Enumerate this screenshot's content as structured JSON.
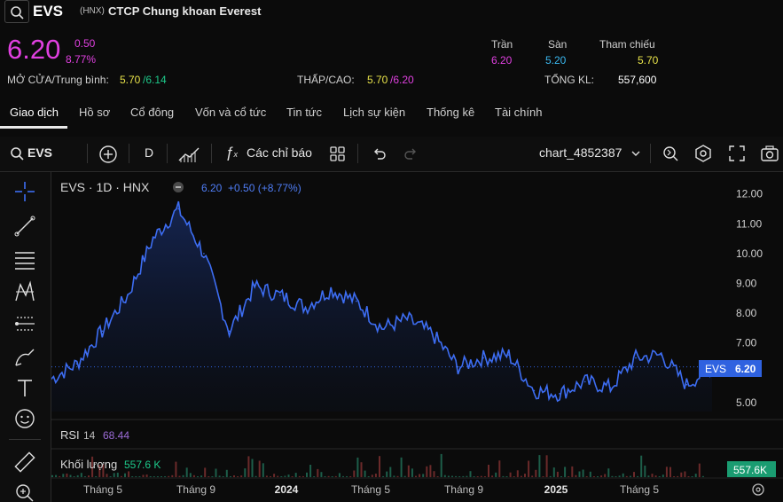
{
  "header": {
    "symbol": "EVS",
    "exchange": "(HNX)",
    "company": "CTCP Chung khoan Everest",
    "price": "6.20",
    "change": "0.50",
    "change_pct": "8.77%",
    "open_avg_label": "MỞ CỬA/Trung bình:",
    "open": "5.70",
    "avg": "/6.14",
    "lowhigh_label": "THẤP/CAO:",
    "low": "5.70",
    "high": "/6.20",
    "ceiling_label": "Trần",
    "ceiling": "6.20",
    "floor_label": "Sàn",
    "floor": "5.20",
    "ref_label": "Tham chiếu",
    "ref": "5.70",
    "volume_label": "TỔNG KL:",
    "volume": "557,600"
  },
  "tabs": [
    "Giao dịch",
    "Hồ sơ",
    "Cổ đông",
    "Vốn và cổ tức",
    "Tin tức",
    "Lịch sự kiện",
    "Thống kê",
    "Tài chính"
  ],
  "toolbar": {
    "symbol": "EVS",
    "interval": "D",
    "indicators": "Các chỉ báo",
    "layout_name": "chart_4852387"
  },
  "icons": {
    "search": "search-icon",
    "plus": "add-symbol-icon",
    "bars": "bar-style-icon",
    "fx": "indicator-icon",
    "grid": "layout-grid-icon",
    "undo": "undo-icon",
    "redo": "redo-icon",
    "chevron": "chevron-down-icon",
    "fullscreen": "fullscreen-icon",
    "camera": "camera-icon",
    "settings": "settings-icon"
  },
  "legend": {
    "title": "EVS · 1D · HNX",
    "last": "6.20",
    "delta": "+0.50 (+8.77%)"
  },
  "rsi": {
    "label": "RSI",
    "period": "14",
    "value": "68.44"
  },
  "volume_pane": {
    "label": "Khối lượng",
    "value": "557.6 K",
    "badge": "557.6K"
  },
  "price_badge": {
    "symbol": "EVS",
    "value": "6.20"
  },
  "colors": {
    "line": "#3d6df2",
    "accent": "#e040e0",
    "volume": "#1dc98a"
  },
  "chart_data": {
    "type": "line",
    "series": [
      {
        "name": "EVS",
        "x": [
          "2023-04",
          "2023-05",
          "2023-06",
          "2023-07",
          "2023-08",
          "2023-09",
          "2023-10",
          "2023-11",
          "2023-12",
          "2024-01",
          "2024-02",
          "2024-03",
          "2024-04",
          "2024-05",
          "2024-06",
          "2024-07",
          "2024-08",
          "2024-09",
          "2024-10",
          "2024-11",
          "2024-12",
          "2025-01",
          "2025-02",
          "2025-03",
          "2025-04",
          "2025-05",
          "2025-06"
        ],
        "values": [
          5.8,
          6.3,
          7.4,
          8.6,
          10.5,
          11.5,
          10.0,
          7.4,
          8.9,
          8.6,
          8.2,
          8.8,
          8.4,
          7.5,
          7.8,
          7.3,
          6.2,
          6.5,
          6.6,
          5.4,
          5.3,
          5.7,
          5.5,
          6.5,
          6.6,
          5.6,
          6.2
        ]
      }
    ],
    "x_ticks": [
      "Tháng 5",
      "Tháng 9",
      "2024",
      "Tháng 5",
      "Tháng 9",
      "2025",
      "Tháng 5"
    ],
    "y_ticks": [
      "12.00",
      "11.00",
      "10.00",
      "9.00",
      "8.00",
      "7.00",
      "5.00"
    ],
    "ylim": [
      4.7,
      12.2
    ],
    "grid": false
  }
}
